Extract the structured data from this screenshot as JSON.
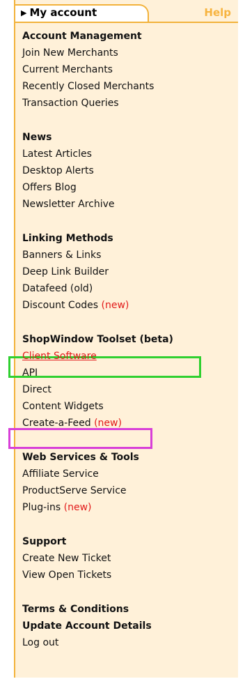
{
  "tabs": {
    "my_account": "My account",
    "help": "Help"
  },
  "menu": {
    "account_management": {
      "heading": "Account Management",
      "items": [
        "Join New Merchants",
        "Current Merchants",
        "Recently Closed Merchants",
        "Transaction Queries"
      ]
    },
    "news": {
      "heading": "News",
      "items": [
        "Latest Articles",
        "Desktop Alerts",
        "Offers Blog",
        "Newsletter Archive"
      ]
    },
    "linking_methods": {
      "heading": "Linking Methods",
      "items": [
        "Banners & Links",
        "Deep Link Builder",
        "Datafeed (old)",
        "Discount Codes"
      ],
      "new_badge": "(new)"
    },
    "shopwindow": {
      "heading": "ShopWindow Toolset (beta)",
      "items": [
        "Client Software",
        "API",
        "Direct",
        "Content Widgets",
        "Create-a-Feed"
      ],
      "new_badge": "(new)"
    },
    "web_services": {
      "heading": "Web Services & Tools",
      "items": [
        "Affiliate Service",
        "ProductServe Service",
        "Plug-ins"
      ],
      "new_badge": "(new)"
    },
    "support": {
      "heading": "Support",
      "items": [
        "Create New Ticket",
        "View Open Tickets"
      ]
    },
    "footer": {
      "items": [
        "Terms & Conditions",
        "Update Account Details",
        "Log out"
      ]
    }
  },
  "colors": {
    "panel_bg": "#fff1d9",
    "border": "#f2b23a",
    "help_text": "#f7b440",
    "new_red": "#e21a1a",
    "highlight_green": "#2fd02f",
    "highlight_magenta": "#d83fd8"
  },
  "icons": {
    "tab_arrow": "triangle-right-icon"
  }
}
